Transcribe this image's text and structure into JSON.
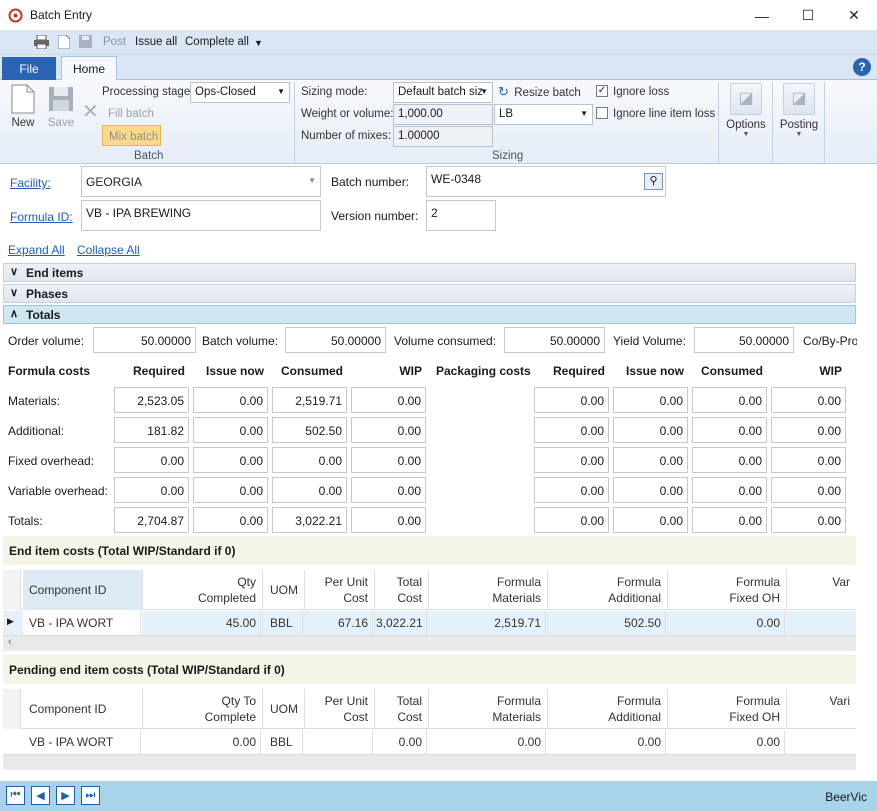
{
  "window": {
    "title": "Batch Entry",
    "minimize": "—",
    "maximize": "☐",
    "close": "✕"
  },
  "qat": {
    "post": "Post",
    "issue_all": "Issue all",
    "complete_all": "Complete all"
  },
  "tabs": {
    "file": "File",
    "home": "Home",
    "help": "?"
  },
  "ribbon": {
    "new": "New",
    "save": "Save",
    "fill_batch": "Fill batch",
    "mix_batch": "Mix batch",
    "group_batch": "Batch",
    "processing_stage_label": "Processing stage:",
    "processing_stage_value": "Ops-Closed",
    "sizing_mode_label": "Sizing mode:",
    "sizing_mode_value": "Default batch siz",
    "resize_batch": "Resize batch",
    "ignore_loss": "Ignore loss",
    "ignore_line_item_loss": "Ignore line item loss",
    "weight_label": "Weight or volume:",
    "weight_value": "1,000.00",
    "uom_value": "LB",
    "mixes_label": "Number of mixes:",
    "mixes_value": "1.00000",
    "group_sizing": "Sizing",
    "options": "Options",
    "posting": "Posting"
  },
  "header": {
    "facility_label": "Facility:",
    "facility_value": "GEORGIA",
    "batch_number_label": "Batch number:",
    "batch_number_value": "WE-0348",
    "formula_label": "Formula ID:",
    "formula_value": "VB - IPA BREWING",
    "version_label": "Version number:",
    "version_value": "2",
    "expand_all": "Expand All",
    "collapse_all": "Collapse All"
  },
  "sections": {
    "end_items": "End items",
    "phases": "Phases",
    "totals": "Totals"
  },
  "totals": {
    "order_volume_label": "Order volume:",
    "order_volume": "50.00000",
    "batch_volume_label": "Batch volume:",
    "batch_volume": "50.00000",
    "volume_consumed_label": "Volume consumed:",
    "volume_consumed": "50.00000",
    "yield_volume_label": "Yield Volume:",
    "yield_volume": "50.00000",
    "coby_label": "Co/By-Pro",
    "formula_costs": "Formula costs",
    "packaging_costs": "Packaging costs",
    "col_required": "Required",
    "col_issue_now": "Issue now",
    "col_consumed": "Consumed",
    "col_wip": "WIP",
    "rows": [
      {
        "label": "Materials:",
        "f": [
          "2,523.05",
          "0.00",
          "2,519.71",
          "0.00"
        ],
        "p": [
          "0.00",
          "0.00",
          "0.00",
          "0.00"
        ]
      },
      {
        "label": "Additional:",
        "f": [
          "181.82",
          "0.00",
          "502.50",
          "0.00"
        ],
        "p": [
          "0.00",
          "0.00",
          "0.00",
          "0.00"
        ]
      },
      {
        "label": "Fixed overhead:",
        "f": [
          "0.00",
          "0.00",
          "0.00",
          "0.00"
        ],
        "p": [
          "0.00",
          "0.00",
          "0.00",
          "0.00"
        ]
      },
      {
        "label": "Variable overhead:",
        "f": [
          "0.00",
          "0.00",
          "0.00",
          "0.00"
        ],
        "p": [
          "0.00",
          "0.00",
          "0.00",
          "0.00"
        ]
      },
      {
        "label": "Totals:",
        "f": [
          "2,704.87",
          "0.00",
          "3,022.21",
          "0.00"
        ],
        "p": [
          "0.00",
          "0.00",
          "0.00",
          "0.00"
        ]
      }
    ]
  },
  "end_item_costs": {
    "title": "End item costs (Total WIP/Standard if 0)",
    "headers": [
      "Component ID",
      "Qty\nCompleted",
      "UOM",
      "Per Unit\nCost",
      "Total\nCost",
      "Formula\nMaterials",
      "Formula\nAdditional",
      "Formula\nFixed OH",
      "Var"
    ],
    "row": [
      "VB - IPA WORT",
      "45.00",
      "BBL",
      "67.16",
      "3,022.21",
      "2,519.71",
      "502.50",
      "0.00"
    ]
  },
  "pending": {
    "title": "Pending end item costs (Total WIP/Standard if 0)",
    "headers": [
      "Component ID",
      "Qty To\nComplete",
      "UOM",
      "Per Unit\nCost",
      "Total\nCost",
      "Formula\nMaterials",
      "Formula\nAdditional",
      "Formula\nFixed OH",
      "Vari"
    ],
    "row": [
      "VB - IPA WORT",
      "0.00",
      "BBL",
      "",
      "0.00",
      "0.00",
      "0.00",
      "0.00"
    ]
  },
  "status": {
    "user": "BeerVic"
  },
  "colors": {
    "accent": "#2b63b5",
    "status_bar": "#a8d4ea",
    "mix_batch_bg": "#fbd98b",
    "totals_header": "#cfe7f3"
  }
}
